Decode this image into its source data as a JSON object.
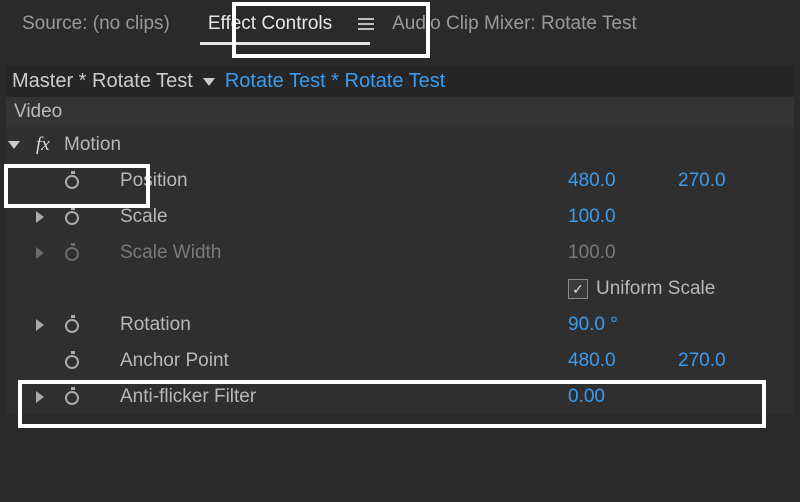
{
  "tabs": {
    "source": "Source: (no clips)",
    "effect_controls": "Effect Controls",
    "audio_mixer": "Audio Clip Mixer: Rotate Test"
  },
  "clip": {
    "master": "Master * Rotate Test",
    "instance": "Rotate Test * Rotate Test"
  },
  "section_video": "Video",
  "effects": {
    "motion": {
      "name": "Motion",
      "props": {
        "position": {
          "label": "Position",
          "x": "480.0",
          "y": "270.0"
        },
        "scale": {
          "label": "Scale",
          "value": "100.0"
        },
        "scale_width": {
          "label": "Scale Width",
          "value": "100.0"
        },
        "uniform_scale": {
          "label": "Uniform Scale",
          "checked": true
        },
        "rotation": {
          "label": "Rotation",
          "value": "90.0 °"
        },
        "anchor_point": {
          "label": "Anchor Point",
          "x": "480.0",
          "y": "270.0"
        },
        "anti_flicker": {
          "label": "Anti-flicker Filter",
          "value": "0.00"
        }
      }
    }
  }
}
